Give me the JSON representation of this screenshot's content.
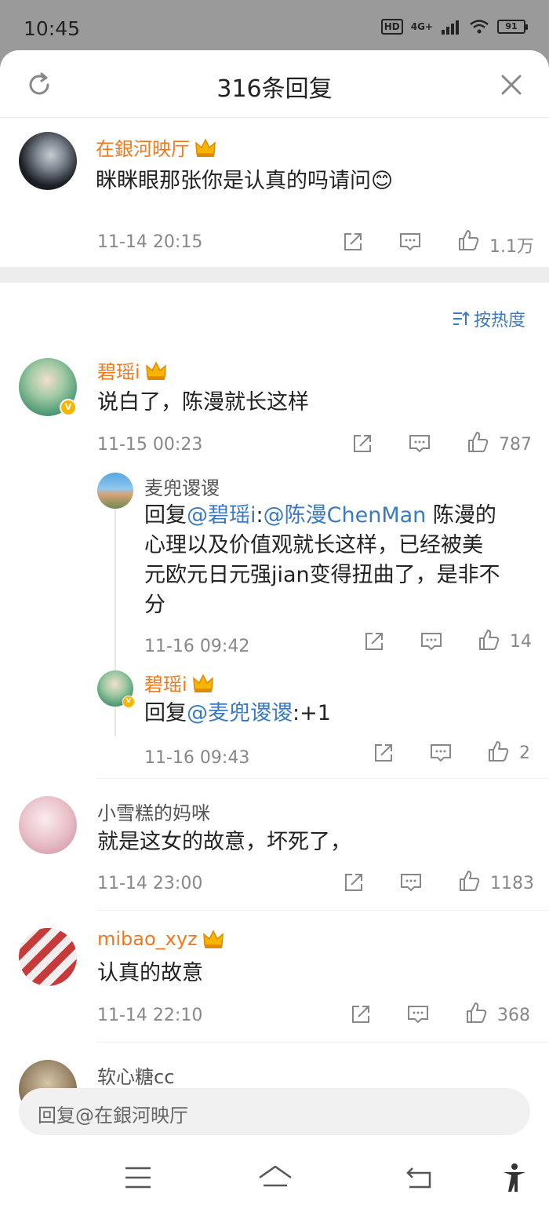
{
  "status_bar": {
    "time": "10:45",
    "hd": "HD",
    "network": "4G+",
    "battery": "91"
  },
  "header": {
    "title": "316条回复"
  },
  "root_comment": {
    "username": "在銀河映厅",
    "text": "眯眯眼那张你是认真的吗请问😊",
    "time": "11-14 20:15",
    "likes": "1.1万"
  },
  "sort": {
    "label": "按热度"
  },
  "comments": [
    {
      "username": "碧瑶i",
      "text": "说白了，陈漫就长这样",
      "time": "11-15 00:23",
      "likes": "787"
    },
    {
      "username": "小雪糕的妈咪",
      "text": "就是这女的故意，坏死了，",
      "time": "11-14 23:00",
      "likes": "1183"
    },
    {
      "username": "mibao_xyz",
      "text": "认真的故意",
      "time": "11-14 22:10",
      "likes": "368"
    },
    {
      "username": "软心糖cc"
    }
  ],
  "replies": [
    {
      "username": "麦兜谡谡",
      "prefix": "回复",
      "mention": "@碧瑶i",
      "colon": ":",
      "mention2": "@陈漫ChenMan",
      "line1_rest": " 陈漫的",
      "line2": "心理以及价值观就长这样，已经被美",
      "line3": "元欧元日元强jian变得扭曲了，是非不",
      "line4": "分",
      "time": "11-16 09:42",
      "likes": "14"
    },
    {
      "username": "碧瑶i",
      "prefix": "回复",
      "mention": "@麦兜谡谡",
      "rest": ":+1",
      "time": "11-16 09:43",
      "likes": "2"
    }
  ],
  "reply_bar": {
    "placeholder": "回复@在銀河映厅"
  },
  "colors": {
    "accent_orange": "#ee7a1f",
    "link_blue": "#3a7ac2",
    "meta_gray": "#888888"
  }
}
